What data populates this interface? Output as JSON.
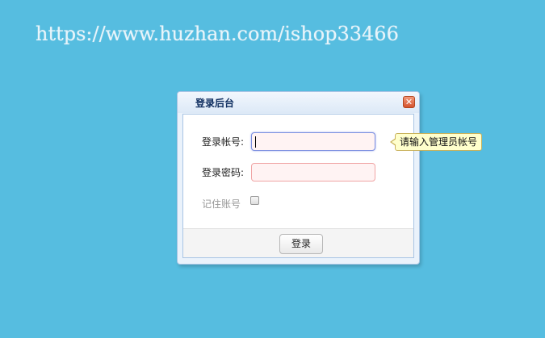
{
  "watermark": "https://www.huzhan.com/ishop33466",
  "dialog": {
    "title": "登录后台",
    "close_glyph": "✕",
    "close_icon": "close-icon"
  },
  "form": {
    "account_label": "登录帐号:",
    "account_value": "",
    "password_label": "登录密码:",
    "password_value": "",
    "remember_label": "记住账号",
    "remember_checked": false,
    "tooltip": "请输入管理员帐号",
    "login_button": "登录"
  },
  "colors": {
    "background": "#56bde0",
    "field_bg": "#fff3f3",
    "field_border": "#f0a5a5",
    "tooltip_bg": "#ffffcc",
    "close_button": "#d5532e"
  }
}
